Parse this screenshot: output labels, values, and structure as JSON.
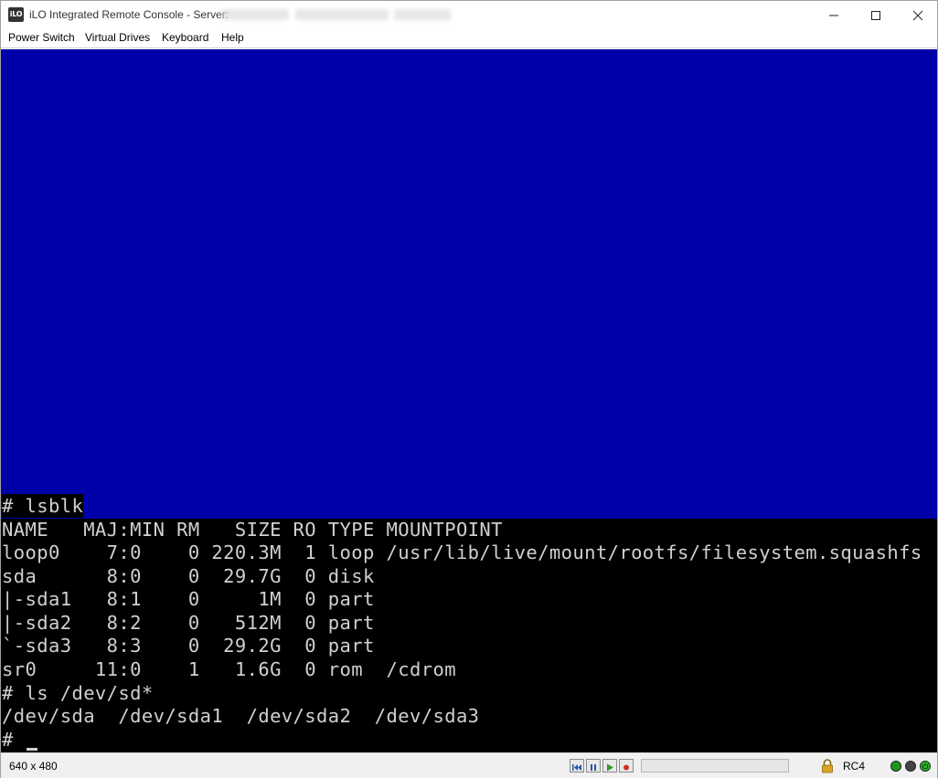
{
  "window": {
    "title": "iLO Integrated Remote Console - Server:",
    "icon_label": "iLO"
  },
  "menu": {
    "items": [
      {
        "label": "Power Switch"
      },
      {
        "label": "Virtual Drives"
      },
      {
        "label": "Keyboard"
      },
      {
        "label": "Help"
      }
    ]
  },
  "console": {
    "lines": [
      "# lsblk",
      "NAME   MAJ:MIN RM   SIZE RO TYPE MOUNTPOINT",
      "loop0    7:0    0 220.3M  1 loop /usr/lib/live/mount/rootfs/filesystem.squashfs",
      "sda      8:0    0  29.7G  0 disk",
      "|-sda1   8:1    0     1M  0 part",
      "|-sda2   8:2    0   512M  0 part",
      "`-sda3   8:3    0  29.2G  0 part",
      "sr0     11:0    1   1.6G  0 rom  /cdrom",
      "# ls /dev/sd*",
      "/dev/sda  /dev/sda1  /dev/sda2  /dev/sda3",
      "#"
    ],
    "colors": {
      "background": "#000000",
      "upper_area": "#0000a8",
      "text": "#d0d0d0"
    }
  },
  "status": {
    "resolution": "640 x 480",
    "encryption": "RC4",
    "playback_progress": 0,
    "icons": [
      "skip-start-icon",
      "pause-icon",
      "play-icon",
      "record-icon",
      "lock-icon"
    ],
    "leds": [
      "#1a9a1a",
      "#444444",
      "#2bbf2b"
    ]
  }
}
